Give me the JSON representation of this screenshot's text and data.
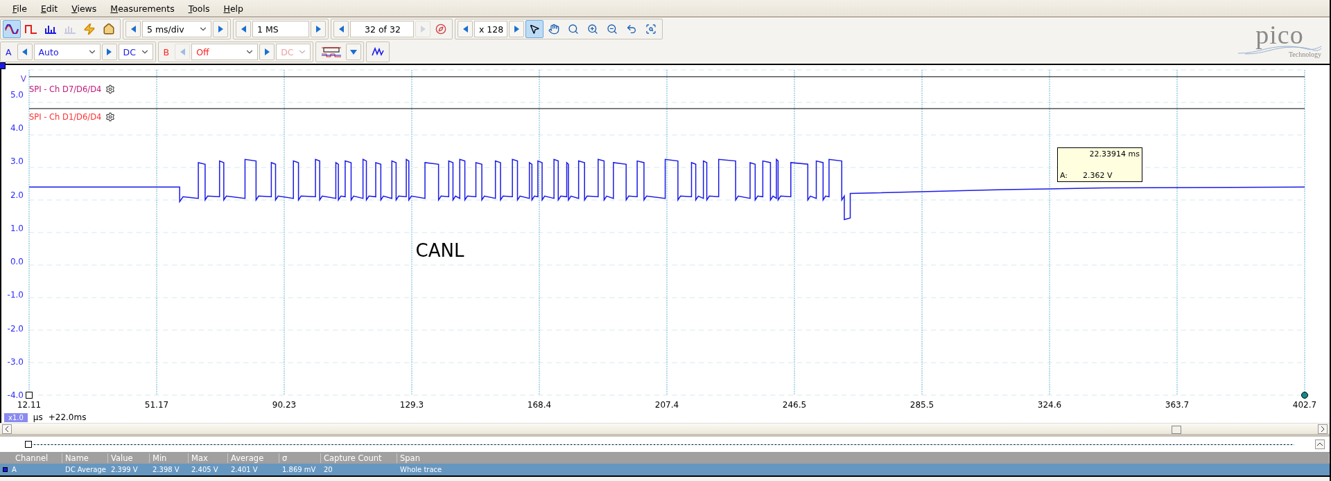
{
  "menu": [
    {
      "label": "File"
    },
    {
      "label": "Edit"
    },
    {
      "label": "Views"
    },
    {
      "label": "Measurements"
    },
    {
      "label": "Tools"
    },
    {
      "label": "Help"
    }
  ],
  "toolbar": {
    "mode_buttons": [
      {
        "selected": true,
        "disabled": false
      },
      {
        "selected": false,
        "disabled": false
      },
      {
        "selected": false,
        "disabled": false
      },
      {
        "selected": false,
        "disabled": true
      }
    ],
    "timebase": "5 ms/div",
    "samples": "1 MS",
    "buffer": "32 of 32",
    "zoom": "x 128",
    "tool_buttons": [
      {
        "selected": true
      },
      {
        "selected": false
      },
      {
        "selected": false
      },
      {
        "selected": false
      },
      {
        "selected": false
      },
      {
        "selected": false
      },
      {
        "selected": false
      }
    ]
  },
  "channels": [
    {
      "label": "A",
      "color": "#1a1ae6",
      "range": "Auto",
      "coupling": "DC",
      "enabled": true
    },
    {
      "label": "B",
      "color": "#ff2020",
      "range": "Off",
      "coupling": "DC",
      "enabled": false
    }
  ],
  "logo": {
    "name": "pico",
    "tagline": "Technology"
  },
  "plot": {
    "y_unit": "V",
    "y_labels": [
      "5.0",
      "4.0",
      "3.0",
      "2.0",
      "1.0",
      "0.0",
      "-1.0",
      "-2.0",
      "-3.0",
      "-4.0"
    ],
    "decoders": [
      {
        "label": "SPI - Ch D7/D6/D4",
        "color": "#c0187a"
      },
      {
        "label": "SPI - Ch D1/D6/D4",
        "color": "#ff3030"
      }
    ],
    "annotation": "CANL",
    "tooltip": {
      "time": "22.33914 ms",
      "channel": "A:",
      "value": "2.362 V"
    },
    "x_labels": [
      "12.11",
      "51.17",
      "90.23",
      "129.3",
      "168.4",
      "207.4",
      "246.5",
      "285.5",
      "324.6",
      "363.7",
      "402.7"
    ],
    "zoom_badge": "x1.0",
    "unit": "μs",
    "offset": "+22.0ms"
  },
  "measurements": {
    "columns": [
      "Channel",
      "Name",
      "Value",
      "Min",
      "Max",
      "Average",
      "σ",
      "Capture Count",
      "Span"
    ],
    "rows": [
      {
        "selected": true,
        "cells": [
          "A",
          "DC Average",
          "2.399 V",
          "2.398 V",
          "2.405 V",
          "2.401 V",
          "1.869 mV",
          "20",
          "Whole trace"
        ]
      }
    ]
  }
}
